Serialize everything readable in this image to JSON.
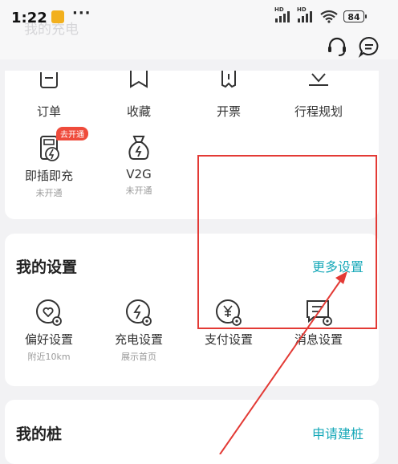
{
  "status_bar": {
    "time": "1:22",
    "more": "···",
    "battery": "84",
    "hd1": "HD",
    "hd2": "HD"
  },
  "header": {
    "ghost_title": "我的充电"
  },
  "services": [
    {
      "label": "订单",
      "icon": "order-icon"
    },
    {
      "label": "收藏",
      "icon": "bookmark-icon"
    },
    {
      "label": "开票",
      "icon": "invoice-icon"
    },
    {
      "label": "行程规划",
      "icon": "route-icon"
    },
    {
      "label": "即插即充",
      "sub": "未开通",
      "badge": "去开通",
      "icon": "plug-charge-icon"
    },
    {
      "label": "V2G",
      "sub": "未开通",
      "icon": "v2g-bag-icon"
    }
  ],
  "settings": {
    "title": "我的设置",
    "more": "更多设置",
    "items": [
      {
        "label": "偏好设置",
        "sub": "附近10km",
        "icon": "preference-settings-icon"
      },
      {
        "label": "充电设置",
        "sub": "展示首页",
        "icon": "charging-settings-icon"
      },
      {
        "label": "支付设置",
        "icon": "payment-settings-icon"
      },
      {
        "label": "消息设置",
        "icon": "message-settings-icon"
      }
    ]
  },
  "pile": {
    "title": "我的桩",
    "apply": "申请建桩"
  },
  "colors": {
    "accent": "#16a8b8",
    "badge": "#ef4b3b",
    "highlight": "#e33a35"
  }
}
